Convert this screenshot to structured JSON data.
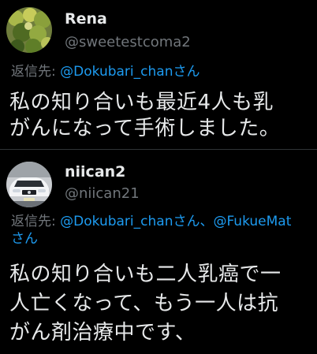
{
  "tweets": [
    {
      "name": "Rena",
      "handle": "@sweetestcoma2",
      "reply_prefix": "返信先: ",
      "reply_mentions": "@Dokubari_chanさん",
      "reply_line2": "",
      "text": "私の知り合いも最近4人も乳\nがんになって手術しました。",
      "avatar_icon": "user-avatar-leaves"
    },
    {
      "name": "niican2",
      "handle": "@niican21",
      "reply_prefix": "返信先: ",
      "reply_mentions": "@Dokubari_chanさん、@FukueMat",
      "reply_line2": "さん",
      "text": "私の知り合いも二人乳癌で一\n人亡くなって、もう一人は抗\nがん剤治療中です、",
      "avatar_icon": "user-avatar-car"
    }
  ],
  "colors": {
    "background": "#000000",
    "text": "#e7e9ea",
    "secondary": "#71767b",
    "link": "#1d9bf0",
    "divider": "#2f3336"
  }
}
